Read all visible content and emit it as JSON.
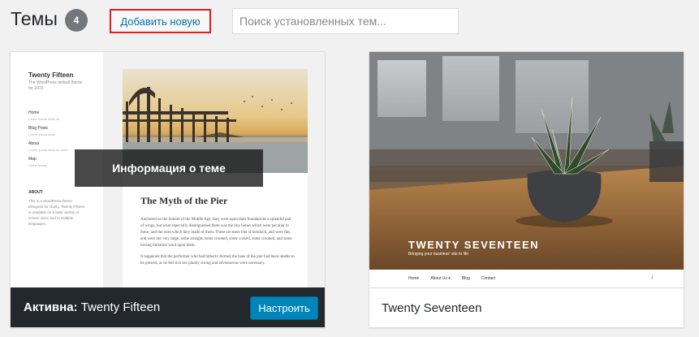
{
  "header": {
    "title": "Темы",
    "count": "4",
    "add_new_label": "Добавить новую",
    "search_placeholder": "Поиск установленных тем..."
  },
  "themes": [
    {
      "name": "Twenty Fifteen",
      "active": true,
      "active_prefix": "Активна:",
      "overlay_label": "Информация о теме",
      "customize_label": "Настроить",
      "preview": {
        "site_title": "Twenty Fifteen",
        "tagline": "The WordPress default theme for 2015",
        "nav": [
          {
            "label": "Home",
            "sub": "Lorem ipsum dolor sit"
          },
          {
            "label": "Blog Posts",
            "sub": "Lorem ipsum dolor"
          },
          {
            "label": "About",
            "sub": "Lorem ipsum dolor sit amet"
          },
          {
            "label": "Map",
            "sub": "Lorem ipsum"
          }
        ],
        "widget_title": "ABOUT",
        "widget_text": "This is a WordPress theme designed for clarity. Twenty Fifteen is readable on a wide variety of screen sizes and in multiple languages.",
        "post_title": "The Myth of the Pier",
        "post_paragraph_1": "Anchored on the bottom of the Middle Age, they were upon their foundations a splendid pair of wings, but what especially distinguished them was the tiny bones which were peculiar to these, and the ones which they made of them. These are mere bits of hemlock, and were flat, and were not very large, some straight, some crooked, some corked, some crooked, and some having imitation wool upon them.",
        "post_paragraph_2": "It happened that the performer who had hitherto formed the base of the pier had been unable to be present, as he fell sick too plainly strong and adventurous were necessary."
      }
    },
    {
      "name": "Twenty Seventeen",
      "active": false,
      "preview": {
        "site_title": "TWENTY SEVENTEEN",
        "tagline": "Bringing your business' site to life",
        "menu": [
          "Home",
          "About Us ▾",
          "Blog",
          "Contact"
        ]
      }
    }
  ],
  "colors": {
    "background": "#f1f1f1",
    "accent": "#0073aa",
    "button": "#0085ba",
    "active_footer": "#23282d",
    "highlight_border": "#dc2020"
  }
}
